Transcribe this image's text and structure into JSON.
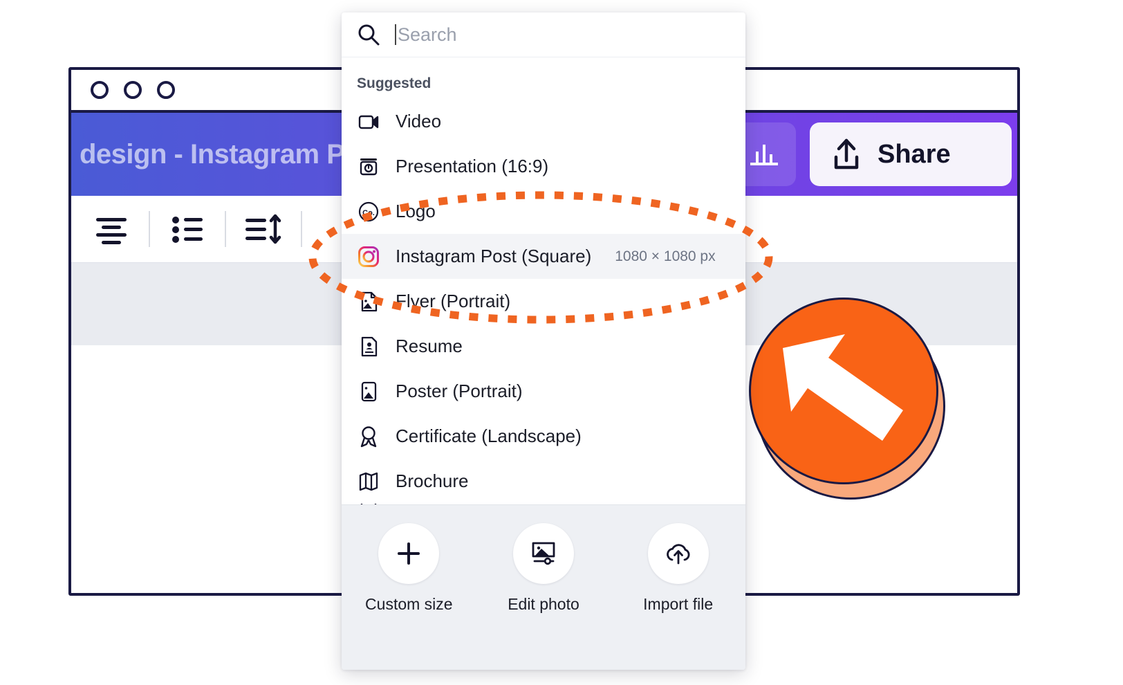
{
  "window": {
    "traffic_lights": [
      "dot-1",
      "dot-2",
      "dot-3"
    ],
    "document_title": "design - Instagram Post",
    "header": {
      "avatar": "user-avatar",
      "add_label": "+",
      "add_icon": "plus-icon",
      "stats_icon": "bar-chart-icon",
      "share_icon": "share-upload-icon",
      "share_label": "Share"
    },
    "toolbar": [
      {
        "name": "text-align-icon",
        "label": "Text align"
      },
      {
        "name": "bullet-list-icon",
        "label": "Bullet list"
      },
      {
        "name": "line-spacing-icon",
        "label": "Line spacing"
      }
    ]
  },
  "panel": {
    "search": {
      "placeholder": "Search",
      "value": "",
      "icon": "search-icon"
    },
    "section_title": "Suggested",
    "items": [
      {
        "label": "Video",
        "icon": "video-camera-icon",
        "dimensions": "",
        "selected": false
      },
      {
        "label": "Presentation (16:9)",
        "icon": "presentation-icon",
        "dimensions": "",
        "selected": false
      },
      {
        "label": "Logo",
        "icon": "logo-co-icon",
        "dimensions": "",
        "selected": false
      },
      {
        "label": "Instagram Post (Square)",
        "icon": "instagram-icon",
        "dimensions": "1080 × 1080 px",
        "selected": true
      },
      {
        "label": "Flyer (Portrait)",
        "icon": "flyer-icon",
        "dimensions": "",
        "selected": false
      },
      {
        "label": "Resume",
        "icon": "resume-icon",
        "dimensions": "",
        "selected": false
      },
      {
        "label": "Poster (Portrait)",
        "icon": "poster-icon",
        "dimensions": "",
        "selected": false
      },
      {
        "label": "Certificate (Landscape)",
        "icon": "certificate-icon",
        "dimensions": "",
        "selected": false
      },
      {
        "label": "Brochure",
        "icon": "brochure-map-icon",
        "dimensions": "",
        "selected": false
      }
    ],
    "footer_actions": [
      {
        "label": "Custom size",
        "icon": "plus-icon"
      },
      {
        "label": "Edit photo",
        "icon": "image-edit-icon"
      },
      {
        "label": "Import file",
        "icon": "cloud-upload-icon"
      }
    ]
  },
  "annotations": {
    "highlight_color": "#ef6421",
    "pointer_badge": {
      "icon": "arrow-up-left-icon",
      "color": "#f96316",
      "shadow_color": "#f9a87c"
    }
  },
  "colors": {
    "header_gradient_start": "#4a5bd6",
    "header_gradient_end": "#7c3ded",
    "sketch_stroke": "#1a1a44",
    "selected_row": "#f3f4f7",
    "footer_bg": "#eef0f4",
    "canvas_band": "#e9ebf0"
  }
}
